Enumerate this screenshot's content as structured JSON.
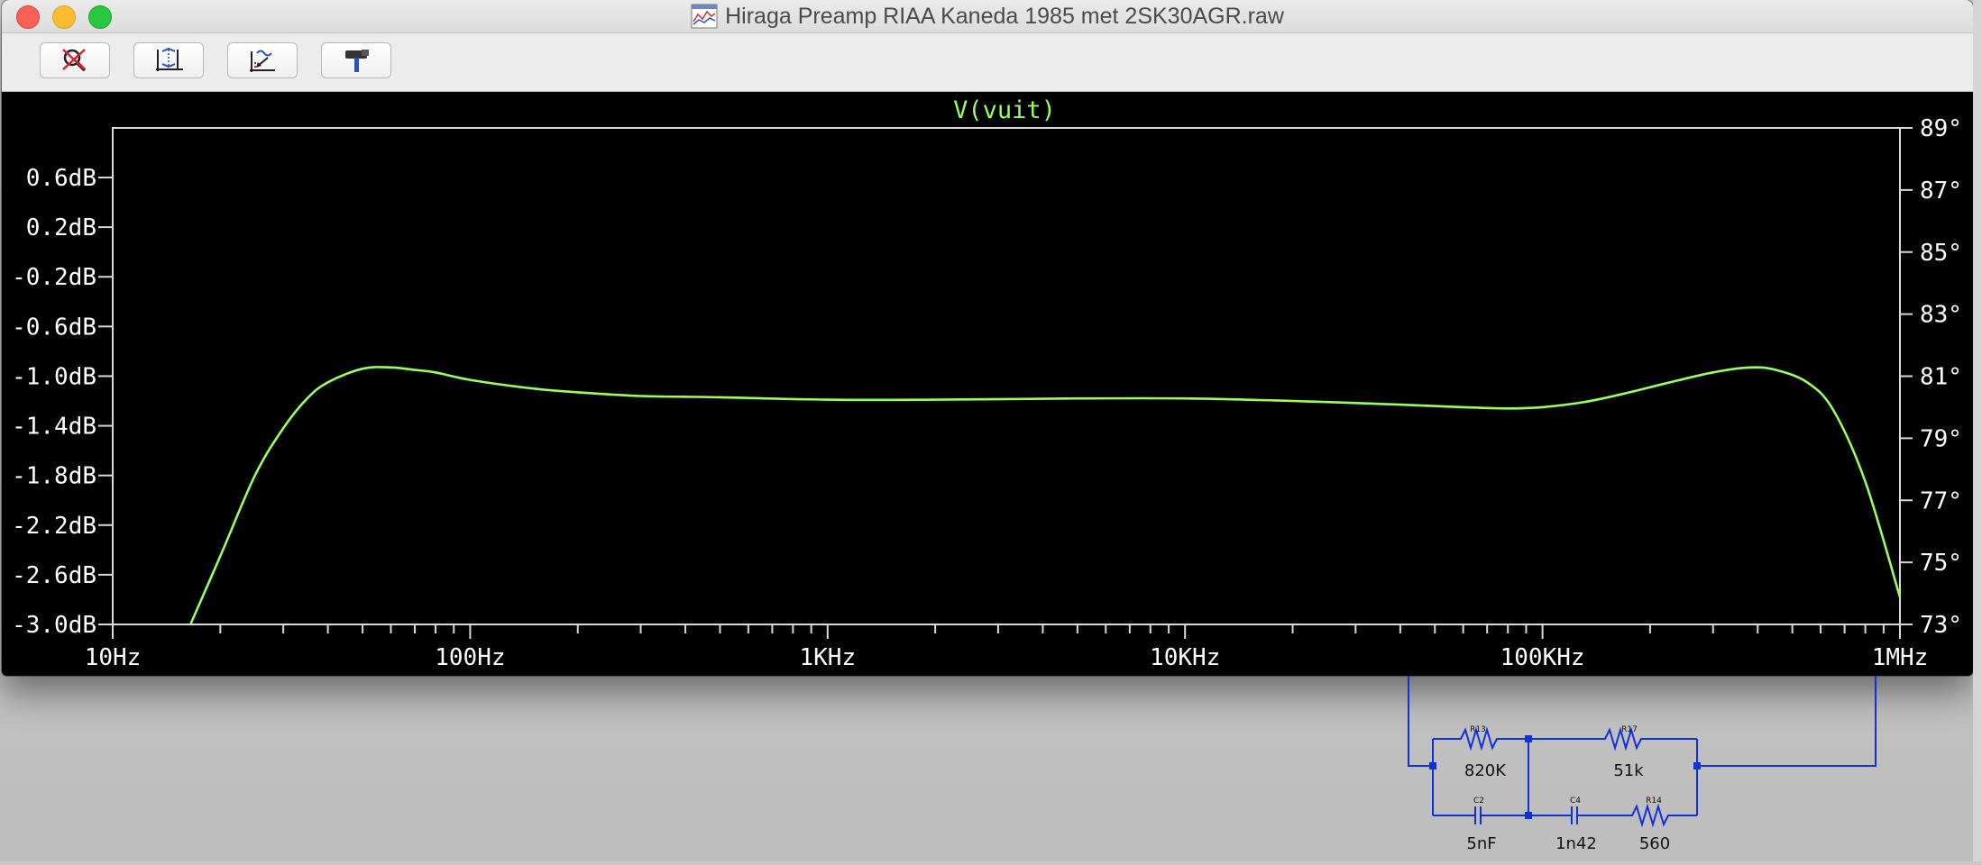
{
  "window": {
    "title": "Hiraga Preamp RIAA Kaneda 1985 met 2SK30AGR.raw",
    "title_icon": "waveform-file-icon"
  },
  "toolbar": {
    "buttons": [
      {
        "name": "zoom-cancel-button",
        "icon": "magnifier-cancel-icon"
      },
      {
        "name": "autorange-button",
        "icon": "autorange-axes-icon"
      },
      {
        "name": "zoom-extents-button",
        "icon": "zoom-graph-icon"
      },
      {
        "name": "pick-visible-traces-button",
        "icon": "hammer-icon"
      }
    ]
  },
  "colors": {
    "trace": "#9aff5a",
    "plot_bg": "#000000",
    "axis": "#d9d9d9",
    "label": "#ffffff",
    "schematic": "#1030d8"
  },
  "chart_data": {
    "type": "line",
    "title": "V(vuit)",
    "x_scale": "log",
    "x_range": [
      10,
      1000000
    ],
    "x_ticks": [
      "10Hz",
      "100Hz",
      "1KHz",
      "10KHz",
      "100KHz",
      "1MHz"
    ],
    "y_left_range": [
      -3.0,
      0.6
    ],
    "y_left_ticks": [
      "0.6dB",
      "0.2dB",
      "-0.2dB",
      "-0.6dB",
      "-1.0dB",
      "-1.4dB",
      "-1.8dB",
      "-2.2dB",
      "-2.6dB",
      "-3.0dB"
    ],
    "y_left_values": [
      0.6,
      0.2,
      -0.2,
      -0.6,
      -1.0,
      -1.4,
      -1.8,
      -2.2,
      -2.6,
      -3.0
    ],
    "y_right_ticks": [
      "89°",
      "87°",
      "85°",
      "83°",
      "81°",
      "79°",
      "77°",
      "75°",
      "73°"
    ],
    "y_right_values": [
      89,
      87,
      85,
      83,
      81,
      79,
      77,
      75,
      73
    ],
    "series": [
      {
        "name": "V(vuit)",
        "x": [
          16.5,
          20,
          25,
          30,
          35,
          40,
          50,
          60,
          70,
          80,
          100,
          150,
          200,
          300,
          500,
          1000,
          2000,
          5000,
          10000,
          20000,
          40000,
          60000,
          80000,
          100000,
          130000,
          170000,
          220000,
          300000,
          380000,
          450000,
          550000,
          650000,
          800000,
          1000000
        ],
        "y": [
          -3.0,
          -2.45,
          -1.8,
          -1.42,
          -1.18,
          -1.05,
          -0.94,
          -0.93,
          -0.95,
          -0.97,
          -1.03,
          -1.1,
          -1.13,
          -1.16,
          -1.17,
          -1.19,
          -1.19,
          -1.18,
          -1.18,
          -1.2,
          -1.23,
          -1.25,
          -1.26,
          -1.25,
          -1.21,
          -1.14,
          -1.06,
          -0.97,
          -0.93,
          -0.95,
          -1.05,
          -1.27,
          -1.85,
          -2.78
        ]
      }
    ]
  },
  "schematic": {
    "components": [
      {
        "ref": "R13",
        "value": "820K"
      },
      {
        "ref": "R17",
        "value": "51k"
      },
      {
        "ref": "C2",
        "value": "5nF"
      },
      {
        "ref": "C4",
        "value": "1n42"
      },
      {
        "ref": "R14",
        "value": "560"
      }
    ]
  }
}
